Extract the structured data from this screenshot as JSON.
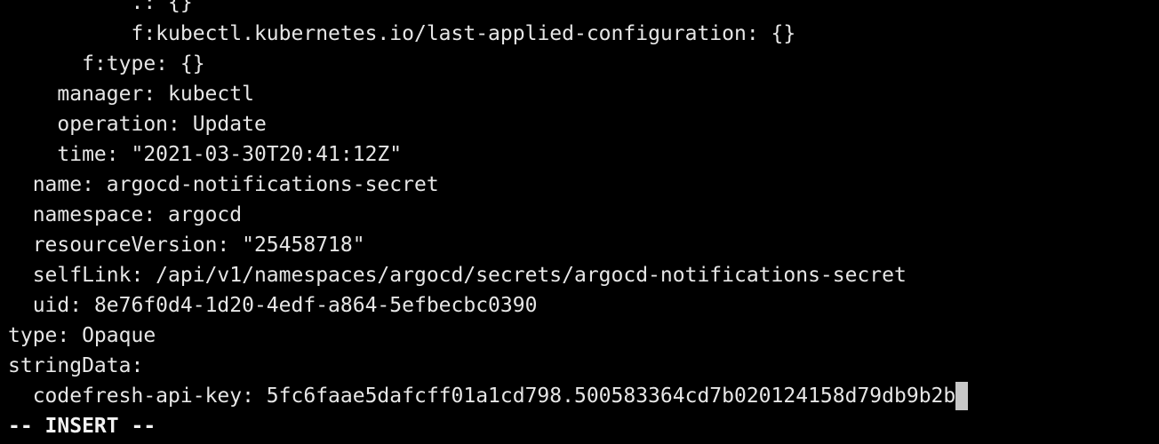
{
  "terminal": {
    "lines": [
      {
        "indent": "          ",
        "text": ".: {}"
      },
      {
        "indent": "          ",
        "text": "f:kubectl.kubernetes.io/last-applied-configuration: {}"
      },
      {
        "indent": "      ",
        "text": "f:type: {}"
      },
      {
        "indent": "    ",
        "text": "manager: kubectl"
      },
      {
        "indent": "    ",
        "text": "operation: Update"
      },
      {
        "indent": "    ",
        "text": "time: \"2021-03-30T20:41:12Z\""
      },
      {
        "indent": "  ",
        "text": "name: argocd-notifications-secret"
      },
      {
        "indent": "  ",
        "text": "namespace: argocd"
      },
      {
        "indent": "  ",
        "text": "resourceVersion: \"25458718\""
      },
      {
        "indent": "  ",
        "text": "selfLink: /api/v1/namespaces/argocd/secrets/argocd-notifications-secret"
      },
      {
        "indent": "  ",
        "text": "uid: 8e76f0d4-1d20-4edf-a864-5efbecbc0390"
      },
      {
        "indent": "",
        "text": "type: Opaque"
      },
      {
        "indent": "",
        "text": "stringData:"
      },
      {
        "indent": "  ",
        "text": "codefresh-api-key: 5fc6faae5dafcff01a1cd798.500583364cd7b020124158d79db9b2b"
      }
    ],
    "mode_indicator": "-- INSERT --"
  },
  "colors": {
    "background": "#000000",
    "foreground": "#e6e6e6",
    "cursor": "#c7c7c7"
  }
}
